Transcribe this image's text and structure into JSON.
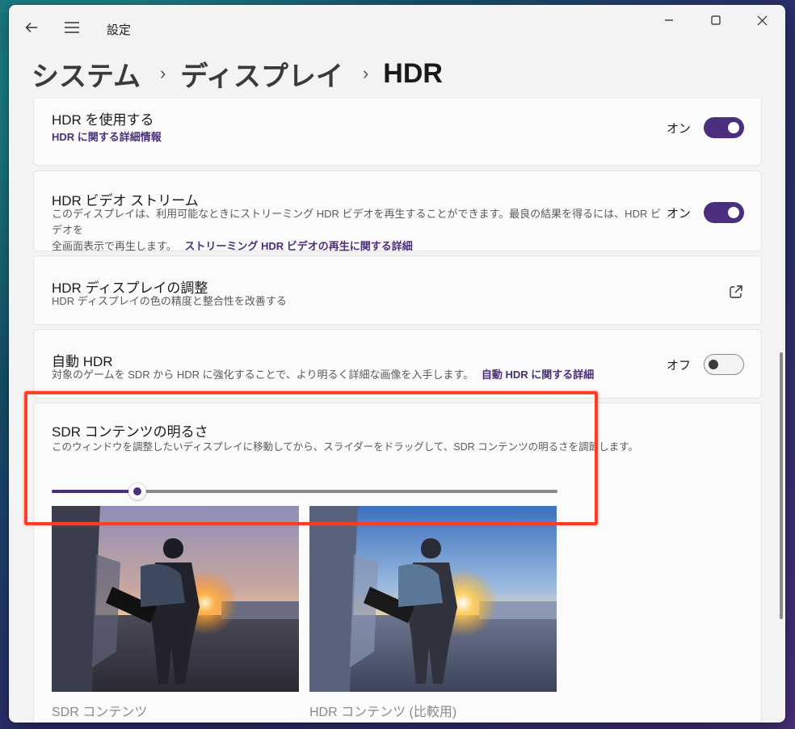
{
  "app": {
    "title": "設定"
  },
  "breadcrumb": {
    "level1": "システム",
    "level2": "ディスプレイ",
    "current": "HDR",
    "separator": "›"
  },
  "settings": {
    "use_hdr": {
      "title": "HDR を使用する",
      "link": "HDR に関する詳細情報",
      "state_label": "オン",
      "enabled": true
    },
    "hdr_video": {
      "title": "HDR ビデオ ストリーム",
      "description_line1": "このディスプレイは、利用可能なときにストリーミング HDR ビデオを再生することができます。最良の結果を得るには、HDR ビデオを",
      "description_line2": "全画面表示で再生します。",
      "link": "ストリーミング HDR ビデオの再生に関する詳細",
      "state_label": "オン",
      "enabled": true
    },
    "calibration": {
      "title": "HDR ディスプレイの調整",
      "description": "HDR ディスプレイの色の精度と整合性を改善する",
      "icon": "open-external-icon"
    },
    "auto_hdr": {
      "title": "自動 HDR",
      "description": "対象のゲームを SDR から HDR に強化することで、より明るく詳細な画像を入手します。",
      "link": "自動 HDR に関する詳細",
      "state_label": "オフ",
      "enabled": false
    },
    "sdr_brightness": {
      "title": "SDR コンテンツの明るさ",
      "description": "このウィンドウを調整したいディスプレイに移動してから、スライダーをドラッグして、SDR コンテンツの明るさを調節します。",
      "slider_value": 0.17,
      "sdr_caption": "SDR コンテンツ",
      "hdr_caption": "HDR コンテンツ (比較用)"
    }
  },
  "colors": {
    "accent": "#4b2e7e",
    "highlight": "#ff3d25"
  }
}
